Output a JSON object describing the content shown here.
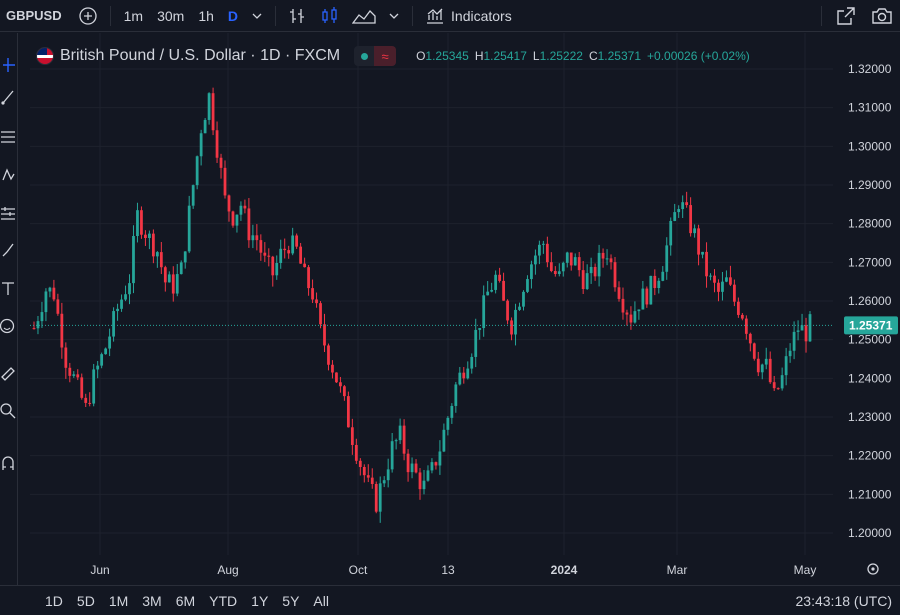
{
  "topbar": {
    "symbol": "GBPUSD",
    "timeframes": [
      "1m",
      "30m",
      "1h",
      "D"
    ],
    "active_timeframe": "D",
    "indicators_label": "Indicators"
  },
  "legend": {
    "title": "British Pound / U.S. Dollar · 1D · FXCM",
    "open_key": "O",
    "open": "1.25345",
    "high_key": "H",
    "high": "1.25417",
    "low_key": "L",
    "low": "1.25222",
    "close_key": "C",
    "close": "1.25371",
    "change": "+0.00026 (+0.02%)"
  },
  "bottombar": {
    "ranges": [
      "1D",
      "5D",
      "1M",
      "3M",
      "6M",
      "YTD",
      "1Y",
      "5Y",
      "All"
    ],
    "clock": "23:43:18 (UTC)"
  },
  "colors": {
    "background": "#131722",
    "up": "#26a69a",
    "down": "#f23645",
    "grid": "#1e222d",
    "accent": "#2962ff"
  },
  "chart_data": {
    "type": "candlestick",
    "symbol": "GBPUSD",
    "interval": "1D",
    "source": "FXCM",
    "y_axis_ticks": [
      "1.32000",
      "1.31000",
      "1.30000",
      "1.29000",
      "1.28000",
      "1.27000",
      "1.26000",
      "1.25000",
      "1.24000",
      "1.23000",
      "1.22000",
      "1.21000",
      "1.20000"
    ],
    "ylim": [
      1.195,
      1.322
    ],
    "x_axis_labels": [
      "Jun",
      "Aug",
      "Oct",
      "13",
      "2024",
      "Mar",
      "May"
    ],
    "x_axis_label_bold": "2024",
    "last_price": "1.25371",
    "last_value": 1.25371,
    "grid": true,
    "price_path": [
      [
        0,
        1.253
      ],
      [
        3,
        1.263
      ],
      [
        5,
        1.262
      ],
      [
        8,
        1.245
      ],
      [
        10,
        1.24
      ],
      [
        13,
        1.232
      ],
      [
        15,
        1.24
      ],
      [
        18,
        1.248
      ],
      [
        21,
        1.258
      ],
      [
        24,
        1.266
      ],
      [
        26,
        1.282
      ],
      [
        29,
        1.276
      ],
      [
        31,
        1.273
      ],
      [
        33,
        1.265
      ],
      [
        35,
        1.264
      ],
      [
        37,
        1.268
      ],
      [
        40,
        1.29
      ],
      [
        42,
        1.305
      ],
      [
        44,
        1.313
      ],
      [
        46,
        1.3
      ],
      [
        48,
        1.286
      ],
      [
        50,
        1.282
      ],
      [
        52,
        1.285
      ],
      [
        54,
        1.278
      ],
      [
        56,
        1.276
      ],
      [
        58,
        1.27
      ],
      [
        60,
        1.267
      ],
      [
        62,
        1.272
      ],
      [
        64,
        1.275
      ],
      [
        66,
        1.273
      ],
      [
        68,
        1.266
      ],
      [
        70,
        1.262
      ],
      [
        72,
        1.252
      ],
      [
        74,
        1.246
      ],
      [
        76,
        1.24
      ],
      [
        78,
        1.233
      ],
      [
        80,
        1.225
      ],
      [
        82,
        1.218
      ],
      [
        84,
        1.212
      ],
      [
        86,
        1.208
      ],
      [
        88,
        1.215
      ],
      [
        90,
        1.222
      ],
      [
        92,
        1.225
      ],
      [
        94,
        1.218
      ],
      [
        96,
        1.215
      ],
      [
        98,
        1.212
      ],
      [
        100,
        1.216
      ],
      [
        102,
        1.222
      ],
      [
        104,
        1.23
      ],
      [
        106,
        1.238
      ],
      [
        108,
        1.243
      ],
      [
        110,
        1.248
      ],
      [
        112,
        1.255
      ],
      [
        114,
        1.262
      ],
      [
        116,
        1.266
      ],
      [
        118,
        1.259
      ],
      [
        120,
        1.254
      ],
      [
        122,
        1.261
      ],
      [
        124,
        1.268
      ],
      [
        126,
        1.272
      ],
      [
        128,
        1.275
      ],
      [
        130,
        1.268
      ],
      [
        132,
        1.266
      ],
      [
        134,
        1.271
      ],
      [
        136,
        1.27
      ],
      [
        138,
        1.266
      ],
      [
        140,
        1.266
      ],
      [
        142,
        1.27
      ],
      [
        144,
        1.273
      ],
      [
        146,
        1.266
      ],
      [
        148,
        1.26
      ],
      [
        150,
        1.256
      ],
      [
        152,
        1.26
      ],
      [
        154,
        1.262
      ],
      [
        156,
        1.265
      ],
      [
        158,
        1.27
      ],
      [
        160,
        1.278
      ],
      [
        162,
        1.286
      ],
      [
        164,
        1.282
      ],
      [
        166,
        1.277
      ],
      [
        168,
        1.27
      ],
      [
        170,
        1.265
      ],
      [
        172,
        1.262
      ],
      [
        174,
        1.265
      ],
      [
        176,
        1.26
      ],
      [
        178,
        1.257
      ],
      [
        180,
        1.25
      ],
      [
        182,
        1.244
      ],
      [
        184,
        1.243
      ],
      [
        186,
        1.235
      ],
      [
        188,
        1.24
      ],
      [
        190,
        1.248
      ],
      [
        192,
        1.253
      ],
      [
        194,
        1.252
      ],
      [
        195,
        1.2537
      ]
    ]
  }
}
